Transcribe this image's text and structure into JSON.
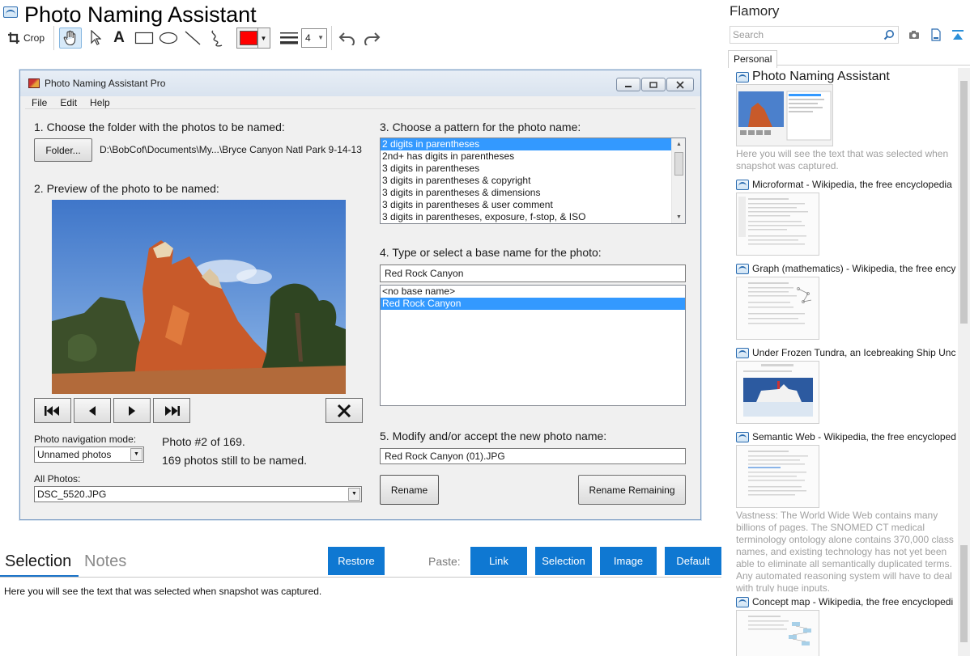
{
  "app": {
    "title": "Photo Naming Assistant"
  },
  "toolbar": {
    "crop_label": "Crop",
    "pen_color": "#ff0000",
    "line_width": "4"
  },
  "window": {
    "title": "Photo Naming Assistant Pro",
    "menu": [
      "File",
      "Edit",
      "Help"
    ],
    "step1": "1. Choose the folder with the photos to be named:",
    "folder_button": "Folder...",
    "folder_path": "D:\\BobCof\\Documents\\My...\\Bryce Canyon Natl Park 9-14-13",
    "step2": "2. Preview of the photo to be named:",
    "nav_mode_label": "Photo navigation mode:",
    "nav_mode_value": "Unnamed photos",
    "photo_position": "Photo #2 of 169.",
    "photos_remaining": "169 photos still to be named.",
    "all_photos_label": "All Photos:",
    "all_photos_value": "DSC_5520.JPG",
    "step3": "3. Choose a pattern for the photo name:",
    "patterns": [
      "2 digits in parentheses",
      "2nd+ has digits in parentheses",
      "3 digits in parentheses",
      "3 digits in parentheses & copyright",
      "3 digits in parentheses & dimensions",
      "3 digits in parentheses & user comment",
      "3 digits in parentheses, exposure, f-stop, & ISO"
    ],
    "step4": "4. Type or select a base name for the photo:",
    "base_name": "Red Rock Canyon",
    "base_names": [
      "<no base name>",
      "Red Rock Canyon"
    ],
    "step5": "5. Modify and/or accept the new photo name:",
    "new_name": "Red Rock Canyon (01).JPG",
    "rename_button": "Rename",
    "rename_remaining_button": "Rename Remaining"
  },
  "bottom": {
    "tab_selection": "Selection",
    "tab_notes": "Notes",
    "restore": "Restore",
    "paste_label": "Paste:",
    "paste_link": "Link",
    "paste_selection": "Selection",
    "paste_image": "Image",
    "paste_default": "Default",
    "selection_text": "Here you will see the text that was selected when snapshot was captured."
  },
  "sidebar": {
    "title": "Flamory",
    "search_placeholder": "Search",
    "tab": "Personal",
    "snapshots": [
      {
        "title": "Photo Naming Assistant",
        "desc": "Here you will see the text that was selected when snapshot was captured."
      },
      {
        "title": "Microformat - Wikipedia, the free encyclopedia"
      },
      {
        "title": "Graph (mathematics) - Wikipedia, the free ency"
      },
      {
        "title": "Under Frozen Tundra, an Icebreaking Ship Unco"
      },
      {
        "title": "Semantic Web - Wikipedia, the free encycloped",
        "desc": "Vastness: The World Wide Web contains many billions of pages. The SNOMED CT medical terminology ontology alone contains 370,000 class names, and existing technology has not yet been able to eliminate all semantically duplicated terms. Any automated reasoning system will have to deal with truly huge inputs."
      },
      {
        "title": "Concept map - Wikipedia, the free encyclopedi"
      }
    ]
  },
  "colors": {
    "accent": "#0f78d2",
    "selection": "#3399ff"
  }
}
